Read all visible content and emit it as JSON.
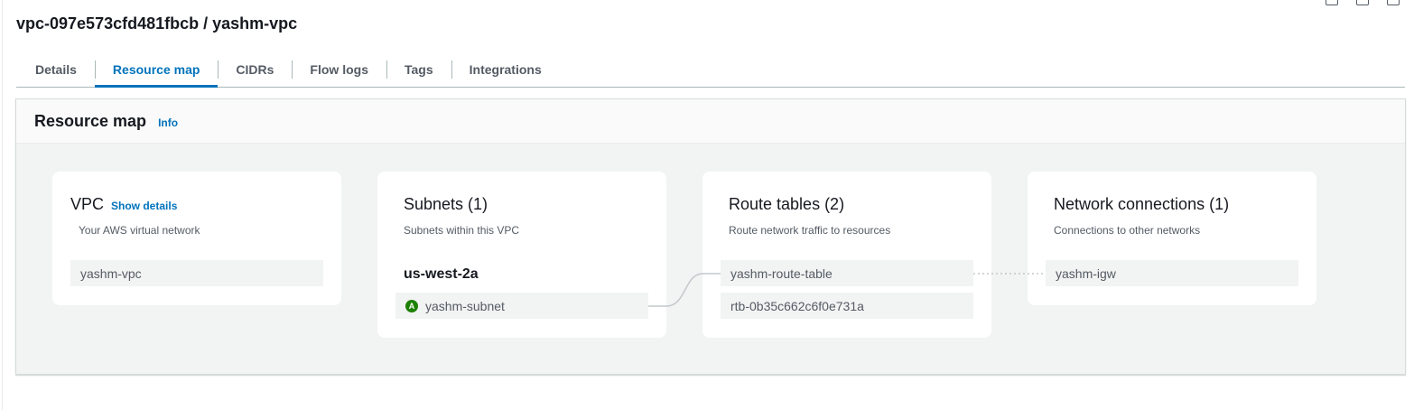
{
  "page": {
    "title": "vpc-097e573cfd481fbcb / yashm-vpc"
  },
  "tabs": [
    {
      "label": "Details",
      "active": false
    },
    {
      "label": "Resource map",
      "active": true
    },
    {
      "label": "CIDRs",
      "active": false
    },
    {
      "label": "Flow logs",
      "active": false
    },
    {
      "label": "Tags",
      "active": false
    },
    {
      "label": "Integrations",
      "active": false
    }
  ],
  "resource_map": {
    "title": "Resource map",
    "info_label": "Info",
    "vpc": {
      "title": "VPC",
      "show_details": "Show details",
      "subtitle": "Your AWS virtual network",
      "items": [
        "yashm-vpc"
      ]
    },
    "subnets": {
      "title": "Subnets (1)",
      "subtitle": "Subnets within this VPC",
      "az": "us-west-2a",
      "az_badge": "A",
      "items": [
        "yashm-subnet"
      ]
    },
    "route_tables": {
      "title": "Route tables (2)",
      "subtitle": "Route network traffic to resources",
      "items": [
        "yashm-route-table",
        "rtb-0b35c662c6f0e731a"
      ]
    },
    "network_connections": {
      "title": "Network connections (1)",
      "subtitle": "Connections to other networks",
      "items": [
        "yashm-igw"
      ]
    }
  },
  "colors": {
    "accent": "#0073bb",
    "badge_green": "#1d8102",
    "item_bg": "#f2f3f3",
    "panel_bg": "#f2f3f3"
  },
  "icons": [
    "settings-icon",
    "copy-icon",
    "share-icon"
  ]
}
